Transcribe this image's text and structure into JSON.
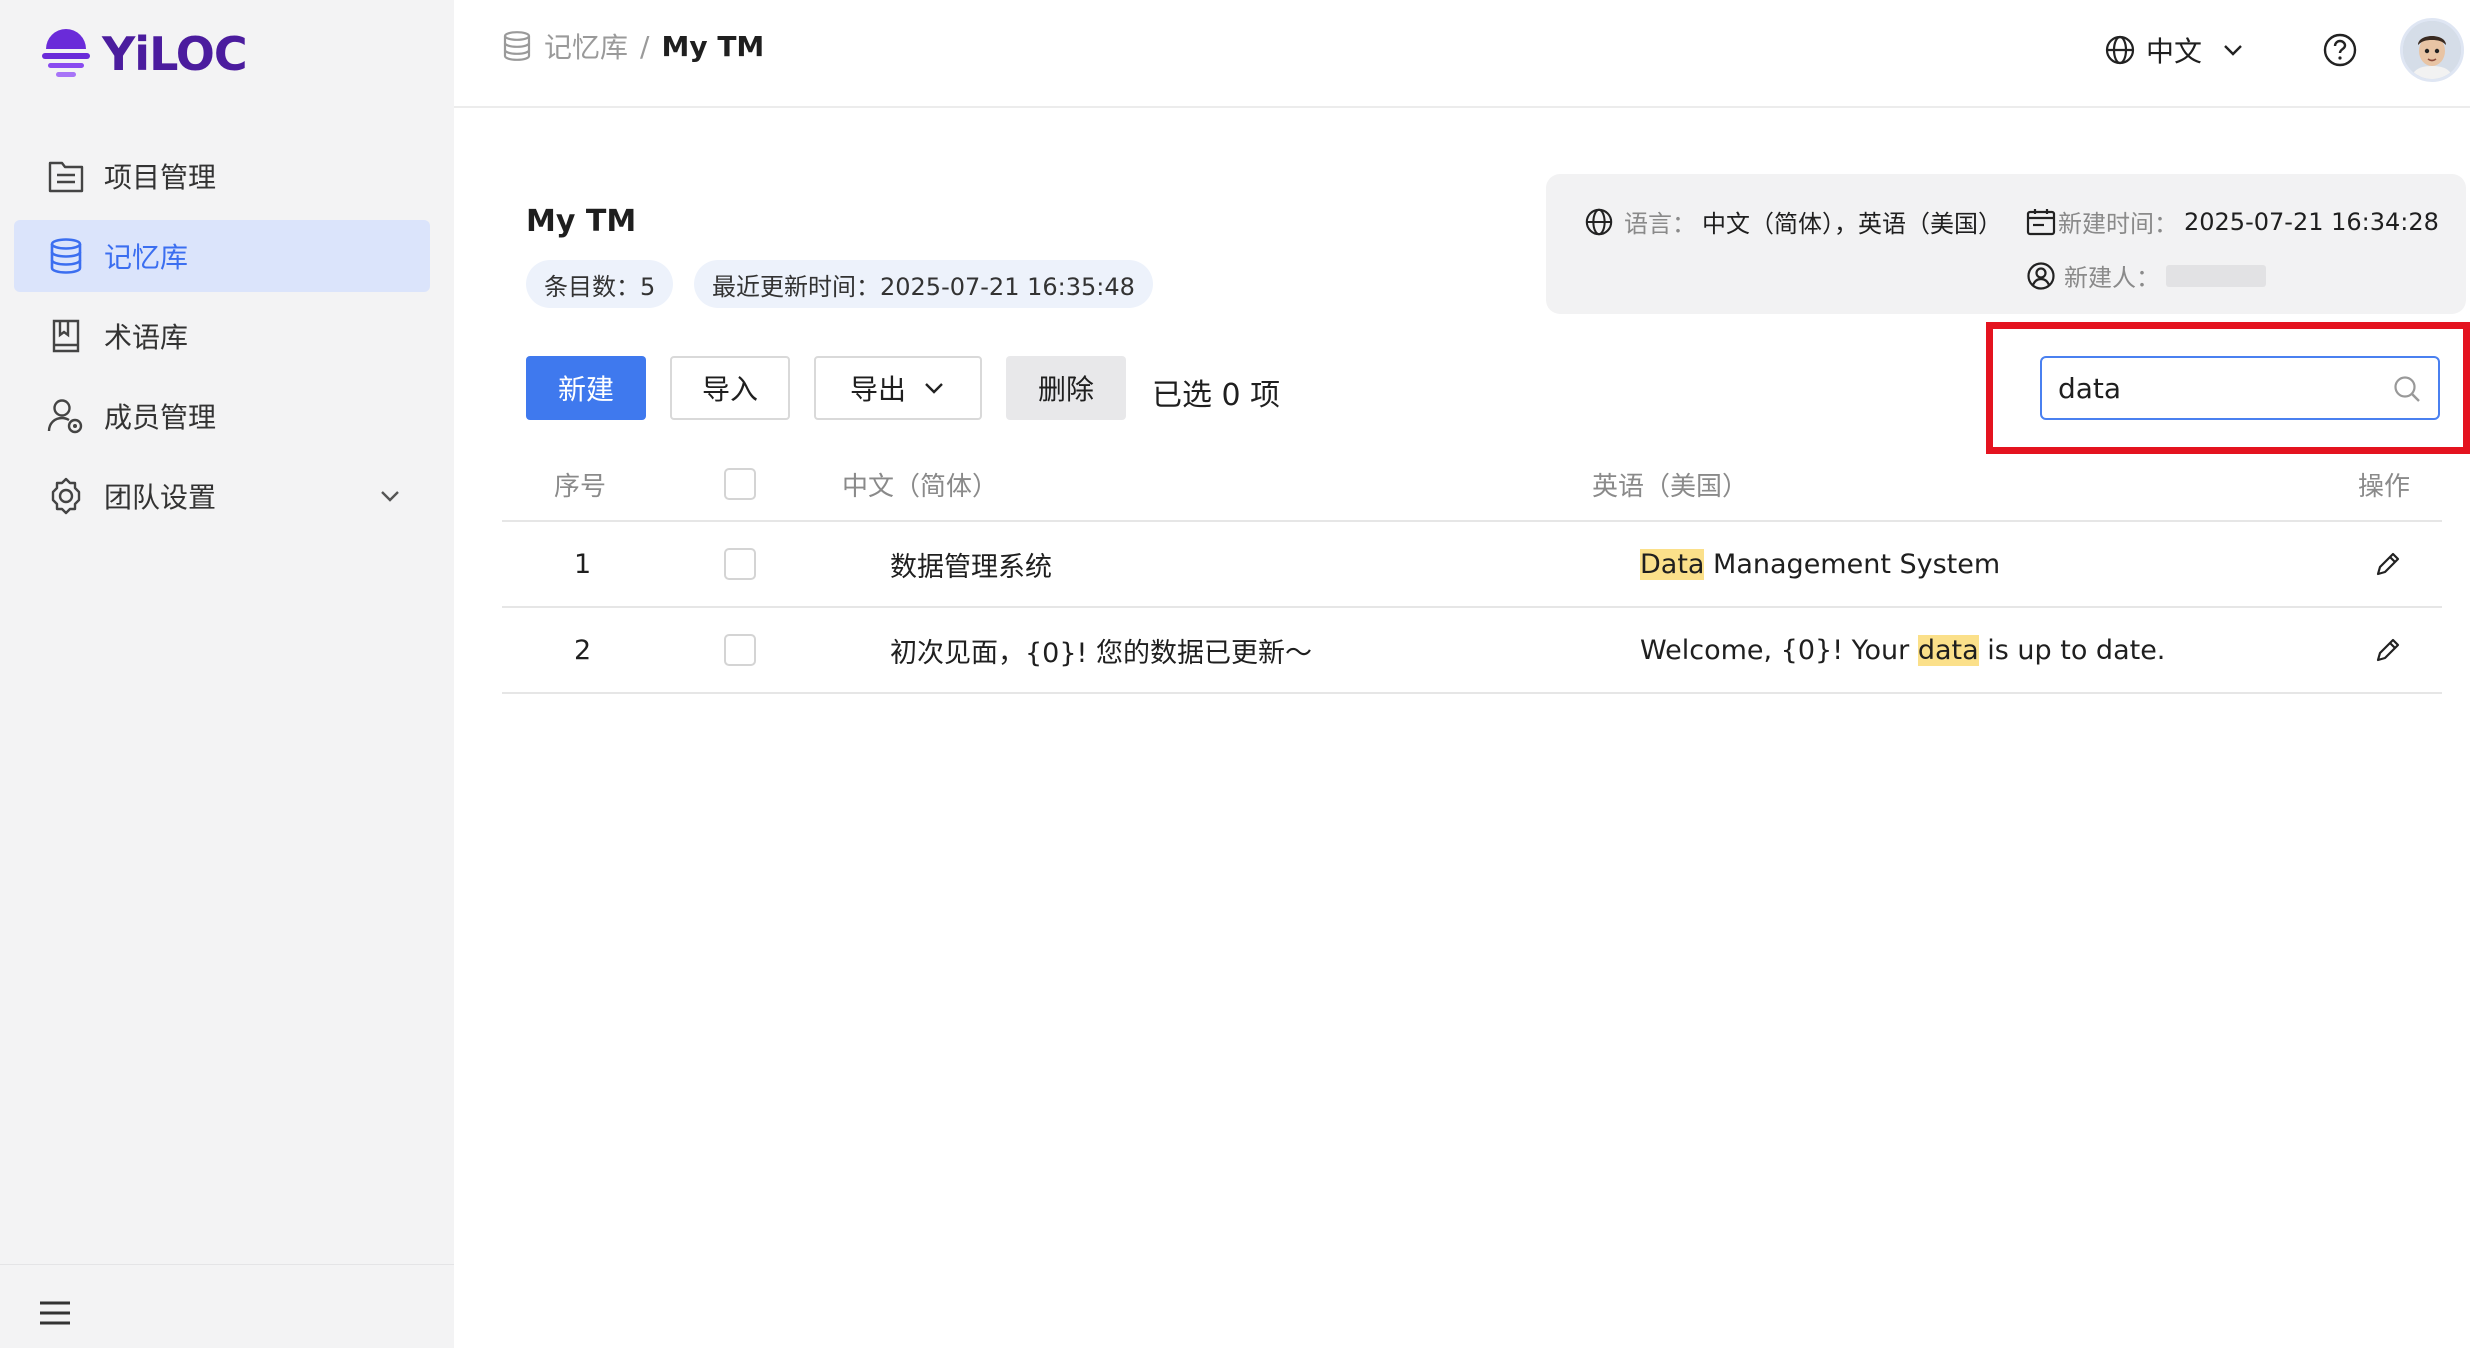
{
  "brand": {
    "name": "YiLOC",
    "color": "#4b1c9e"
  },
  "sidebar": {
    "items": [
      {
        "label": "项目管理",
        "icon": "folder-list-icon",
        "active": false
      },
      {
        "label": "记忆库",
        "icon": "database-icon",
        "active": true
      },
      {
        "label": "术语库",
        "icon": "book-icon",
        "active": false
      },
      {
        "label": "成员管理",
        "icon": "user-settings-icon",
        "active": false
      },
      {
        "label": "团队设置",
        "icon": "gear-icon",
        "active": false,
        "expandable": true
      }
    ],
    "collapse_icon": "menu-icon"
  },
  "header": {
    "breadcrumb_parent": "记忆库",
    "breadcrumb_sep": "/",
    "breadcrumb_current": "My TM",
    "language": "中文",
    "help_icon": "help-circle-icon",
    "avatar_icon": "user-avatar"
  },
  "main": {
    "title": "My TM",
    "entry_count": "条目数：5",
    "last_updated": "最近更新时间：2025-07-21 16:35:48",
    "info": {
      "lang_label": "语言：",
      "lang_value": "中文（简体），英语（美国）",
      "created_label": "新建时间：",
      "created_value": "2025-07-21 16:34:28",
      "creator_label": "新建人："
    },
    "toolbar": {
      "new_label": "新建",
      "import_label": "导入",
      "export_label": "导出",
      "delete_label": "删除",
      "selected_text": "已选 0 项"
    },
    "search": {
      "value": "data",
      "placeholder": ""
    },
    "table": {
      "columns": [
        "序号",
        "中文（简体）",
        "英语（美国）",
        "操作"
      ],
      "rows": [
        {
          "index": "1",
          "source": "数据管理系统",
          "target_pre": "",
          "target_match": "Data",
          "target_post": " Management System"
        },
        {
          "index": "2",
          "source": "初次见面，{0}! 您的数据已更新～",
          "target_pre": "Welcome, {0}! Your ",
          "target_match": "data",
          "target_post": " is up to date."
        }
      ]
    }
  },
  "colors": {
    "accent": "#3f79ee",
    "highlight": "#fbe08a",
    "annotation": "#e4131f"
  }
}
